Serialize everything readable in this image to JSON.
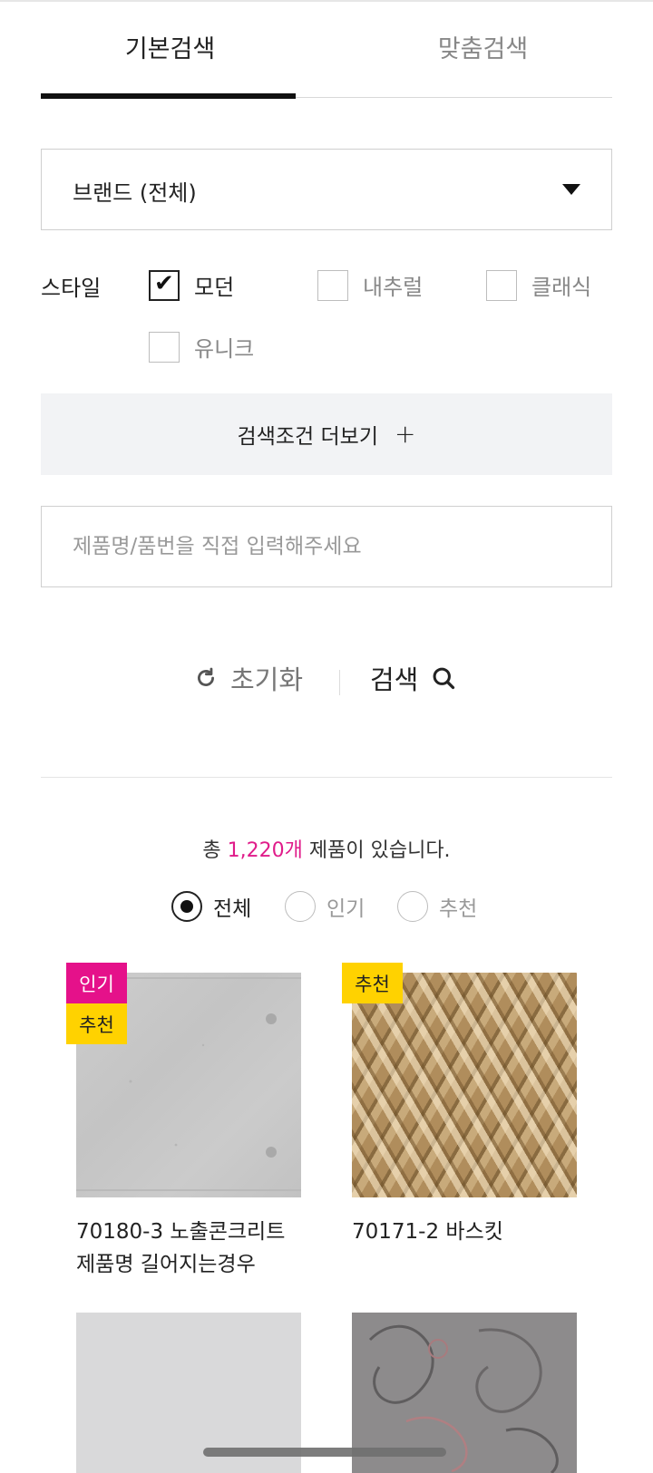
{
  "tabs": {
    "basic": "기본검색",
    "custom": "맞춤검색"
  },
  "brand": {
    "label": "브랜드 (전체)"
  },
  "style": {
    "label": "스타일",
    "options": [
      {
        "label": "모던",
        "checked": true
      },
      {
        "label": "내추럴",
        "checked": false
      },
      {
        "label": "클래식",
        "checked": false
      },
      {
        "label": "유니크",
        "checked": false
      }
    ]
  },
  "more": {
    "label": "검색조건 더보기",
    "icon": "plus-icon"
  },
  "search_input": {
    "placeholder": "제품명/품번을 직접 입력해주세요",
    "value": ""
  },
  "actions": {
    "reset": "초기화",
    "search": "검색"
  },
  "results": {
    "prefix": "총 ",
    "count": "1,220개",
    "suffix": " 제품이 있습니다."
  },
  "filters": [
    {
      "label": "전체",
      "selected": true
    },
    {
      "label": "인기",
      "selected": false
    },
    {
      "label": "추천",
      "selected": false
    }
  ],
  "products": [
    {
      "line1": "70180-3 노출콘크리트",
      "line2": "제품명 길어지는경우",
      "badges": [
        "인기",
        "추천"
      ]
    },
    {
      "line1": "70171-2  바스킷",
      "line2": "",
      "badges": [
        "추천"
      ]
    },
    {
      "line1": "",
      "line2": "",
      "badges": []
    },
    {
      "line1": "",
      "line2": "",
      "badges": []
    }
  ],
  "colors": {
    "accent_pink": "#e5118a",
    "badge_yellow": "#ffd200",
    "count_pink": "#e01c8a"
  }
}
